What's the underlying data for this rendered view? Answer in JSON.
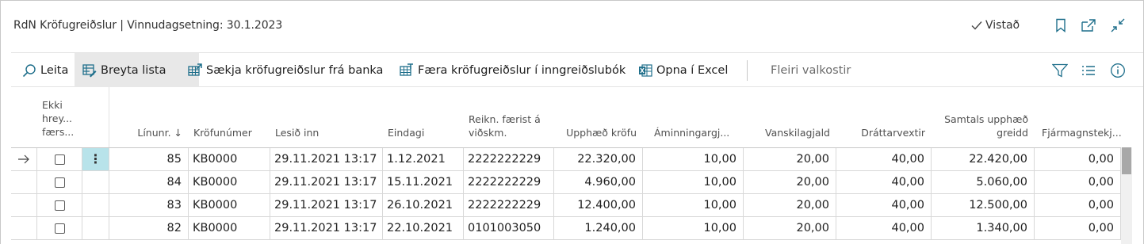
{
  "page": {
    "title": "RdN Kröfugreiðslur | Vinnudagsetning: 30.1.2023",
    "saved_label": "Vistað"
  },
  "actions": {
    "search": "Leita",
    "edit_list": "Breyta lista",
    "fetch": "Sækja kröfugreiðslur frá banka",
    "post": "Færa kröfugreiðslur í inngreiðslubók",
    "excel": "Opna í Excel",
    "more": "Fleiri valkostir"
  },
  "icons": {
    "search": "search-icon",
    "edit_list": "edit-list-icon",
    "fetch": "fetch-icon",
    "post": "post-icon",
    "excel": "excel-icon",
    "bookmark": "bookmark-icon",
    "open_new": "open-new-window-icon",
    "collapse": "collapse-icon",
    "filter": "filter-icon",
    "list": "list-icon",
    "info": "info-icon",
    "check": "check-icon"
  },
  "table": {
    "headers": {
      "nomod": "Ekki hrey... færs...",
      "linenr": "Línunr. ↓",
      "krofunr": "Kröfunúmer",
      "lesid": "Lesið inn",
      "eindagi": "Eindagi",
      "reikn": "Reikn. færist á viðskm.",
      "upph": "Upphæð kröfu",
      "amin": "Áminningargj...",
      "vansk": "Vanskilagjald",
      "drat": "Dráttarvextir",
      "samt": "Samtals upphæð greidd",
      "fjar": "Fjármagnstekj..."
    },
    "rows": [
      {
        "linenr": "85",
        "krofunr": "KB0000",
        "lesid": "29.11.2021 13:17",
        "eindagi": "1.12.2021",
        "reikn": "2222222229",
        "upph": "22.320,00",
        "amin": "10,00",
        "vansk": "20,00",
        "drat": "40,00",
        "samt": "22.420,00",
        "fjar": "0,00"
      },
      {
        "linenr": "84",
        "krofunr": "KB0000",
        "lesid": "29.11.2021 13:17",
        "eindagi": "15.11.2021",
        "reikn": "2222222229",
        "upph": "4.960,00",
        "amin": "10,00",
        "vansk": "20,00",
        "drat": "40,00",
        "samt": "5.060,00",
        "fjar": "0,00"
      },
      {
        "linenr": "83",
        "krofunr": "KB0000",
        "lesid": "29.11.2021 13:17",
        "eindagi": "26.10.2021",
        "reikn": "2222222229",
        "upph": "12.400,00",
        "amin": "10,00",
        "vansk": "20,00",
        "drat": "40,00",
        "samt": "12.500,00",
        "fjar": "0,00"
      },
      {
        "linenr": "82",
        "krofunr": "KB0000",
        "lesid": "29.11.2021 13:17",
        "eindagi": "22.10.2021",
        "reikn": "0101003050",
        "upph": "1.240,00",
        "amin": "10,00",
        "vansk": "20,00",
        "drat": "40,00",
        "samt": "1.340,00",
        "fjar": "0,00"
      }
    ]
  },
  "colors": {
    "accent": "#1f6f8b",
    "selected_cell": "#b8e3ea",
    "active_button": "#e8e8e8"
  }
}
